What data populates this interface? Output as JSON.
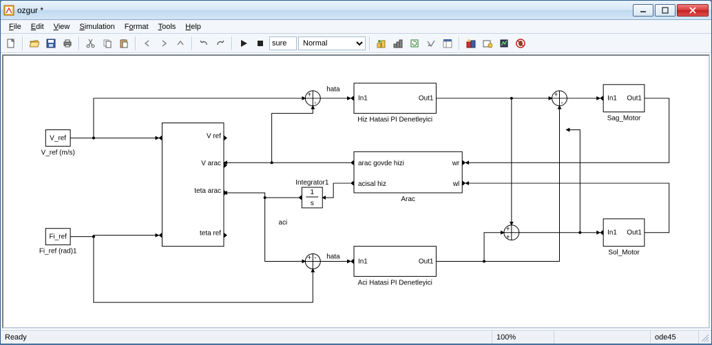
{
  "window": {
    "title": "ozgur *"
  },
  "menu": {
    "file": "File",
    "file_hot": "F",
    "edit": "Edit",
    "edit_hot": "E",
    "view": "View",
    "view_hot": "V",
    "simulation": "Simulation",
    "sim_hot": "S",
    "format": "Format",
    "format_hot": "o",
    "tools": "Tools",
    "tools_hot": "T",
    "help": "Help",
    "help_hot": "H"
  },
  "toolbar": {
    "time_input": "sure",
    "mode": "Normal"
  },
  "blocks": {
    "vref": {
      "label": "V_ref",
      "caption": "V_ref (m/s)"
    },
    "firef": {
      "label": "Fi_ref",
      "caption": "Fi_ref (rad)1"
    },
    "mux": {
      "p1": "V ref",
      "p2": "V arac",
      "p3": "teta arac",
      "p4": "teta ref"
    },
    "integrator": {
      "num": "1",
      "den": "s",
      "caption": "Integrator1"
    },
    "hiz": {
      "in": "In1",
      "out": "Out1",
      "caption": "Hiz Hatasi PI Denetleyici"
    },
    "arac": {
      "out1": "arac govde hizi",
      "out2": "acisal hiz",
      "in1": "wr",
      "in2": "wl",
      "caption": "Arac"
    },
    "acih": {
      "in": "In1",
      "out": "Out1",
      "caption": "Aci Hatasi PI Denetleyici"
    },
    "sag": {
      "in": "In1",
      "out": "Out1",
      "caption": "Sag_Motor"
    },
    "sol": {
      "in": "In1",
      "out": "Out1",
      "caption": "Sol_Motor"
    },
    "labels": {
      "hata1": "hata",
      "hata2": "hata",
      "aci": "aci"
    }
  },
  "status": {
    "ready": "Ready",
    "zoom": "100%",
    "solver": "ode45"
  }
}
